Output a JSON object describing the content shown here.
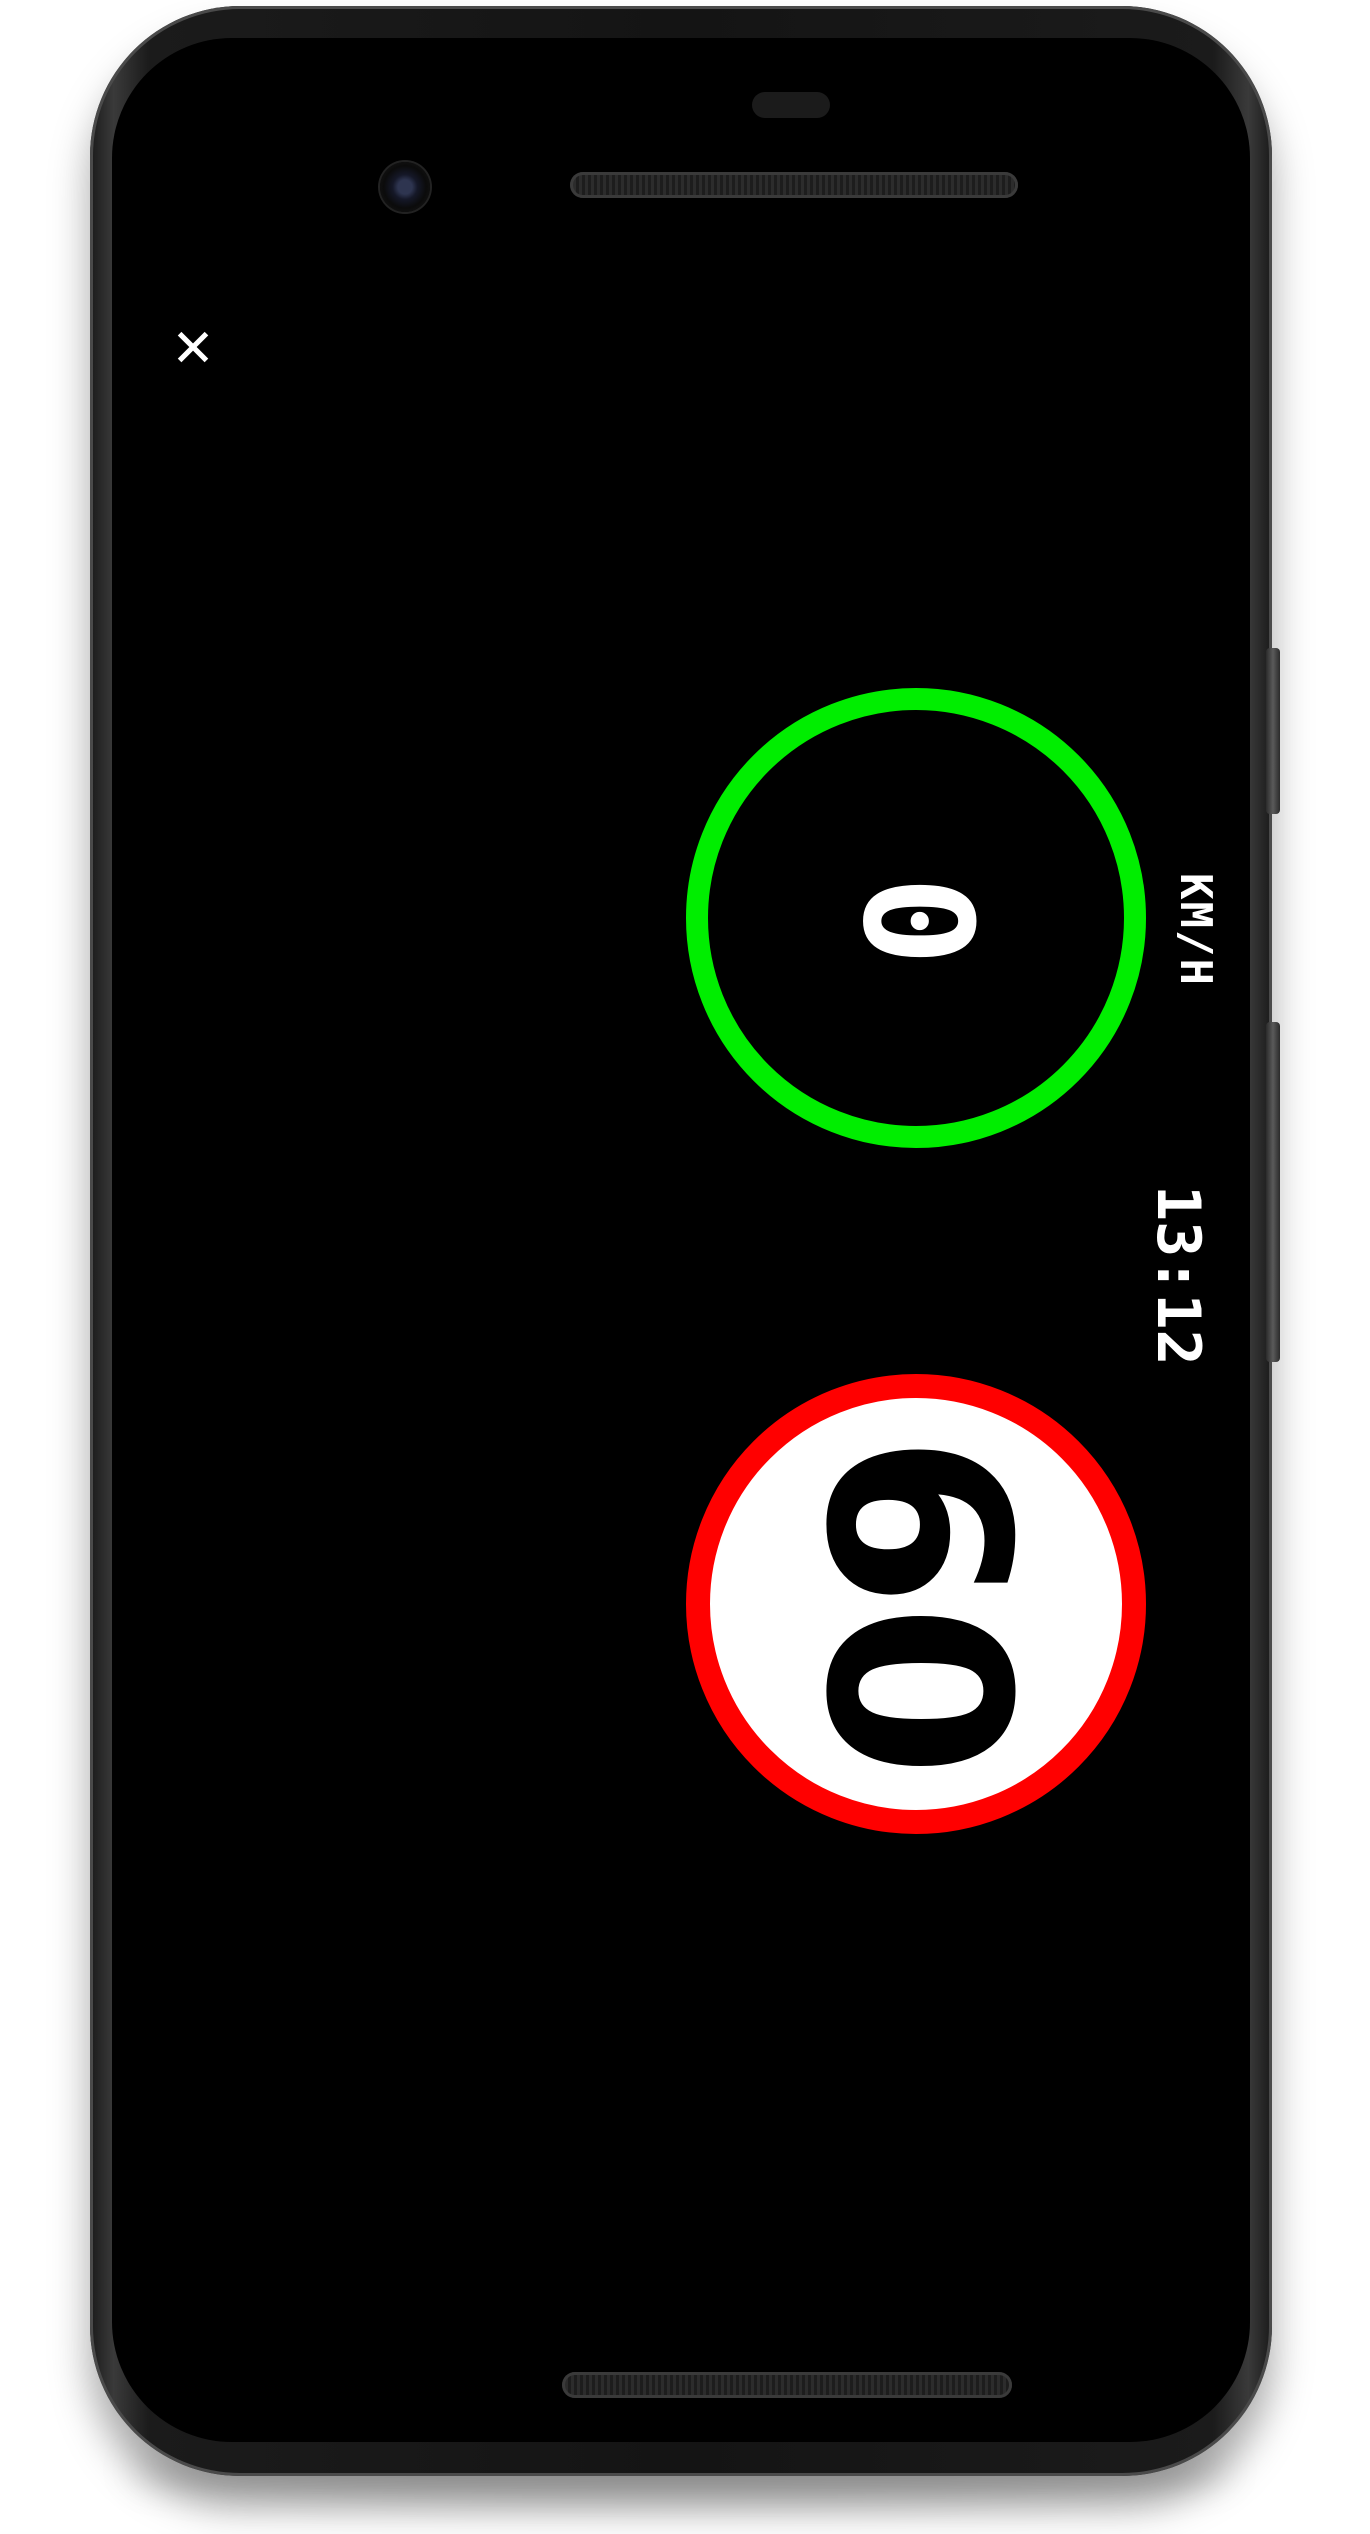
{
  "app": {
    "close_icon_glyph": "✕",
    "speedometer": {
      "current_speed": "0",
      "unit": "KM/H",
      "ring_color": "#00ee00"
    },
    "clock": "13:12",
    "speed_limit": {
      "value": "60",
      "ring_color": "#ff0000",
      "fill_color": "#ffffff"
    }
  }
}
